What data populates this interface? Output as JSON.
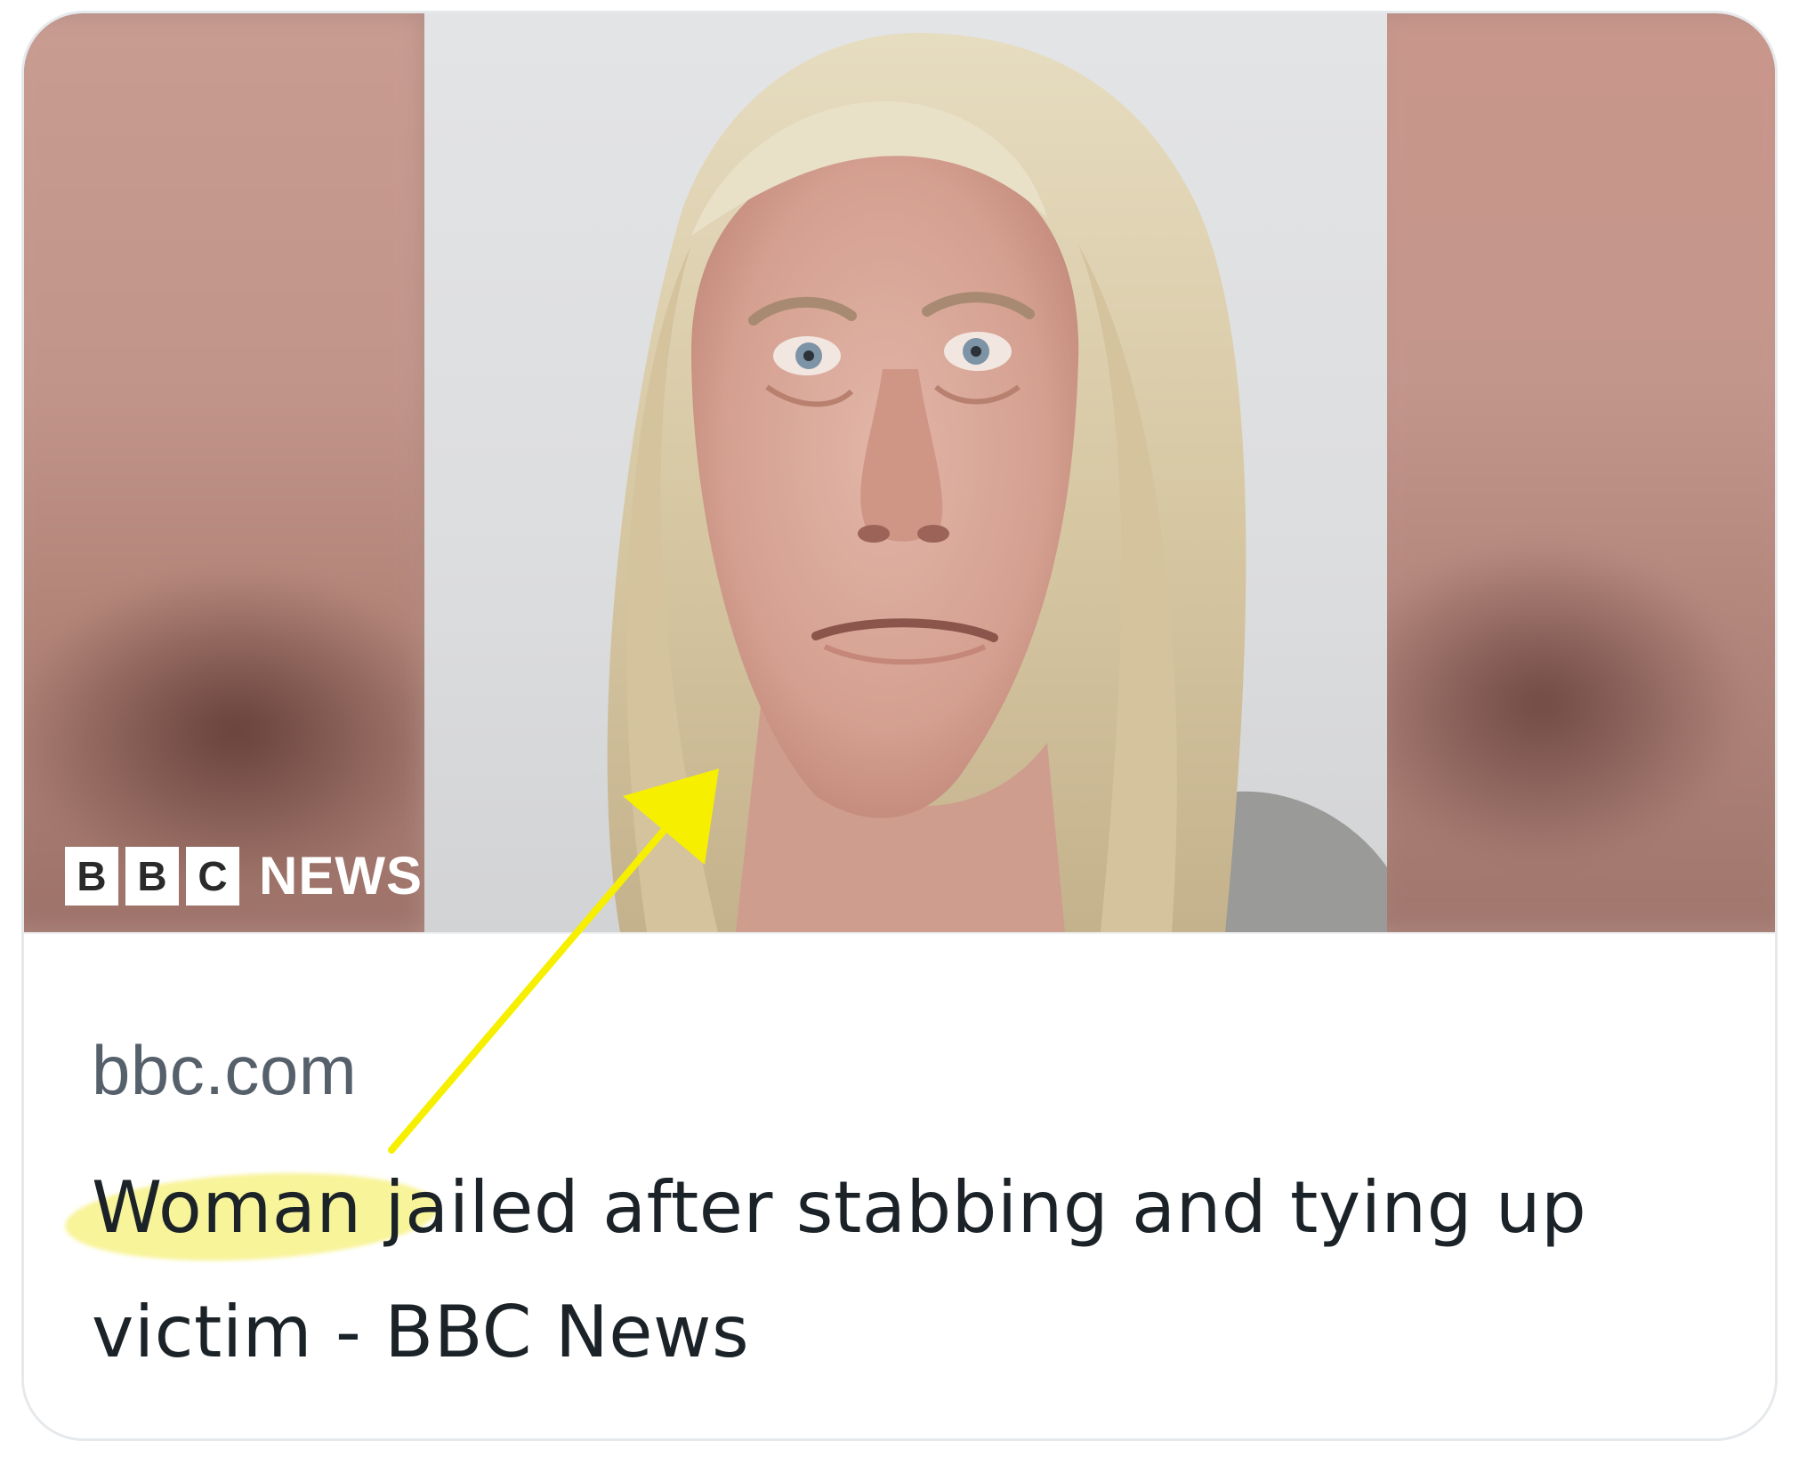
{
  "card": {
    "brand_box_letters": [
      "B",
      "B",
      "C"
    ],
    "brand_news": "NEWS",
    "domain": "bbc.com",
    "headline_word": "Woman",
    "headline_rest": " jailed after stabbing and tying up victim - BBC News"
  },
  "annotation": {
    "arrow_color": "#f7ef00",
    "highlight_color": "#f5f078"
  }
}
